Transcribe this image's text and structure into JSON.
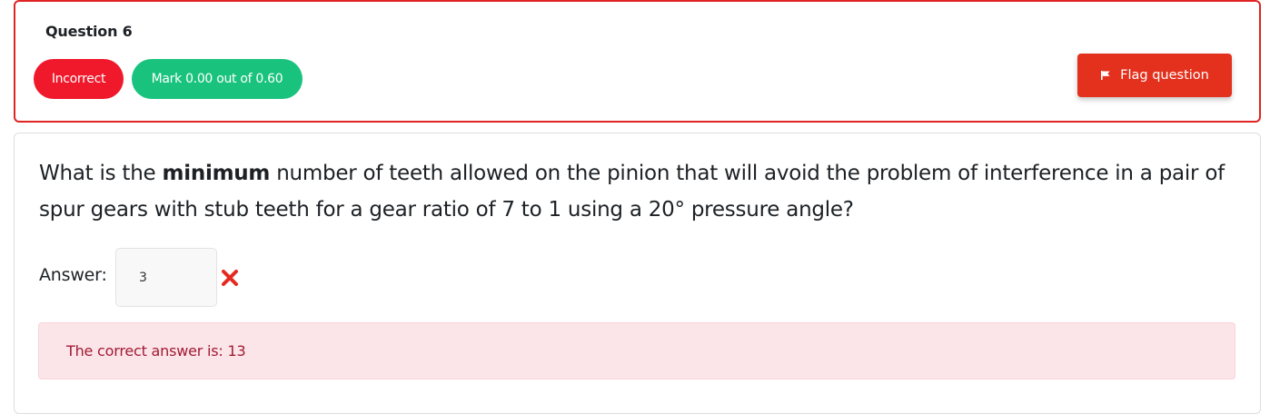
{
  "question": {
    "title": "Question 6",
    "status_badge": "Incorrect",
    "mark_badge": "Mark 0.00 out of 0.60",
    "flag_label": "Flag question",
    "text_before": "What is the ",
    "text_bold": "minimum",
    "text_after": " number of teeth allowed on the pinion that will avoid the problem of interference in a pair of spur gears with stub teeth for a gear ratio of 7 to 1 using a 20° pressure angle?",
    "answer_label": "Answer:",
    "answer_value": "3",
    "feedback": "The correct answer is: 13"
  },
  "colors": {
    "incorrect": "#f0182b",
    "mark": "#19c37d",
    "flag_button": "#e3311e",
    "feedback_bg": "#fce5e8",
    "feedback_text": "#a01a34"
  },
  "icons": {
    "flag": "flag-icon",
    "wrong": "cross-icon"
  }
}
